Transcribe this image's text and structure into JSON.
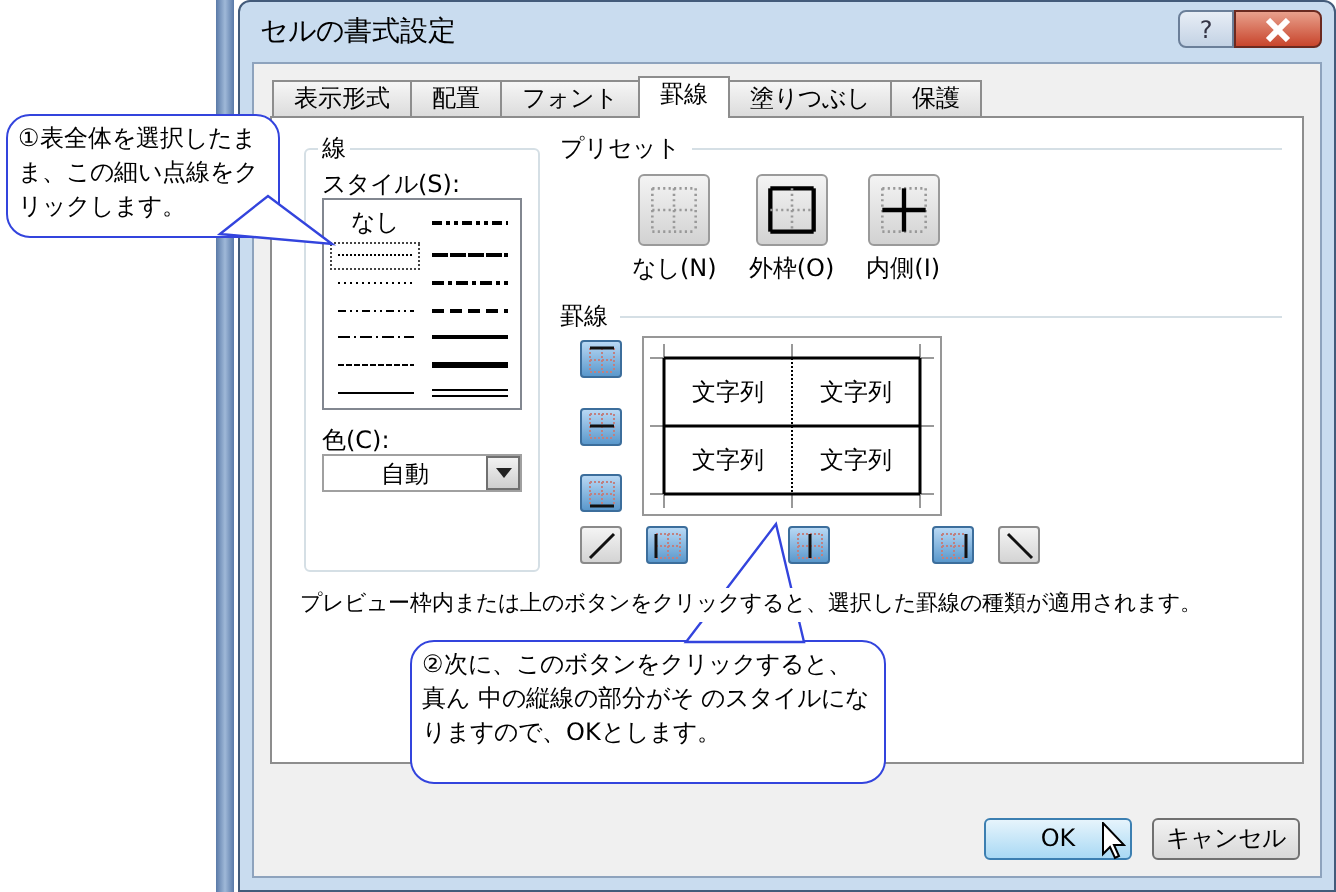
{
  "window": {
    "title": "セルの書式設定",
    "help_label": "?"
  },
  "tabs": [
    {
      "label": "表示形式",
      "selected": false
    },
    {
      "label": "配置",
      "selected": false
    },
    {
      "label": "フォント",
      "selected": false
    },
    {
      "label": "罫線",
      "selected": true
    },
    {
      "label": "塗りつぶし",
      "selected": false
    },
    {
      "label": "保護",
      "selected": false
    }
  ],
  "line": {
    "title": "線",
    "style_label": "スタイル(S):",
    "styles": [
      {
        "kind": "none",
        "label": "なし",
        "selected": false
      },
      {
        "kind": "hair",
        "selected": true
      },
      {
        "kind": "dotted",
        "selected": false
      },
      {
        "kind": "dashdotdot",
        "selected": false
      },
      {
        "kind": "dashdot",
        "selected": false
      },
      {
        "kind": "dashed",
        "selected": false
      },
      {
        "kind": "thin",
        "selected": false
      },
      {
        "kind": "mediumdashdotdot",
        "selected": false
      },
      {
        "kind": "slantdashdot",
        "selected": false
      },
      {
        "kind": "mediumdashdot",
        "selected": false
      },
      {
        "kind": "mediumdashed",
        "selected": false
      },
      {
        "kind": "medium",
        "selected": false
      },
      {
        "kind": "thick",
        "selected": false
      },
      {
        "kind": "double",
        "selected": false
      }
    ],
    "color_label": "色(C):",
    "color_value": "自動"
  },
  "presets": {
    "title": "プリセット",
    "items": [
      {
        "kind": "none",
        "label": "なし(N)"
      },
      {
        "kind": "outline",
        "label": "外枠(O)"
      },
      {
        "kind": "inside",
        "label": "内側(I)"
      }
    ]
  },
  "border": {
    "title": "罫線",
    "side_buttons": [
      {
        "kind": "top",
        "pressed": true
      },
      {
        "kind": "middle",
        "pressed": true
      },
      {
        "kind": "bottom",
        "pressed": true
      }
    ],
    "bottom_buttons": [
      {
        "kind": "diag_up",
        "pressed": false
      },
      {
        "kind": "left",
        "pressed": true
      },
      {
        "kind": "center",
        "pressed": true
      },
      {
        "kind": "right",
        "pressed": true
      },
      {
        "kind": "diag_down",
        "pressed": false
      }
    ],
    "preview_cells": [
      "文字列",
      "文字列",
      "文字列",
      "文字列"
    ]
  },
  "hint": "プレビュー枠内または上のボタンをクリックすると、選択した罫線の種類が適用されます。",
  "buttons": [
    {
      "label": "OK",
      "default": true
    },
    {
      "label": "キャンセル",
      "default": false
    }
  ],
  "callouts": [
    {
      "text": "①表全体を選択したまま、この細い点線をクリックします。"
    },
    {
      "text": "②次に、このボタンをクリックすると、真ん 中の縦線の部分がそ のスタイルになりますので、OKとします。"
    }
  ]
}
